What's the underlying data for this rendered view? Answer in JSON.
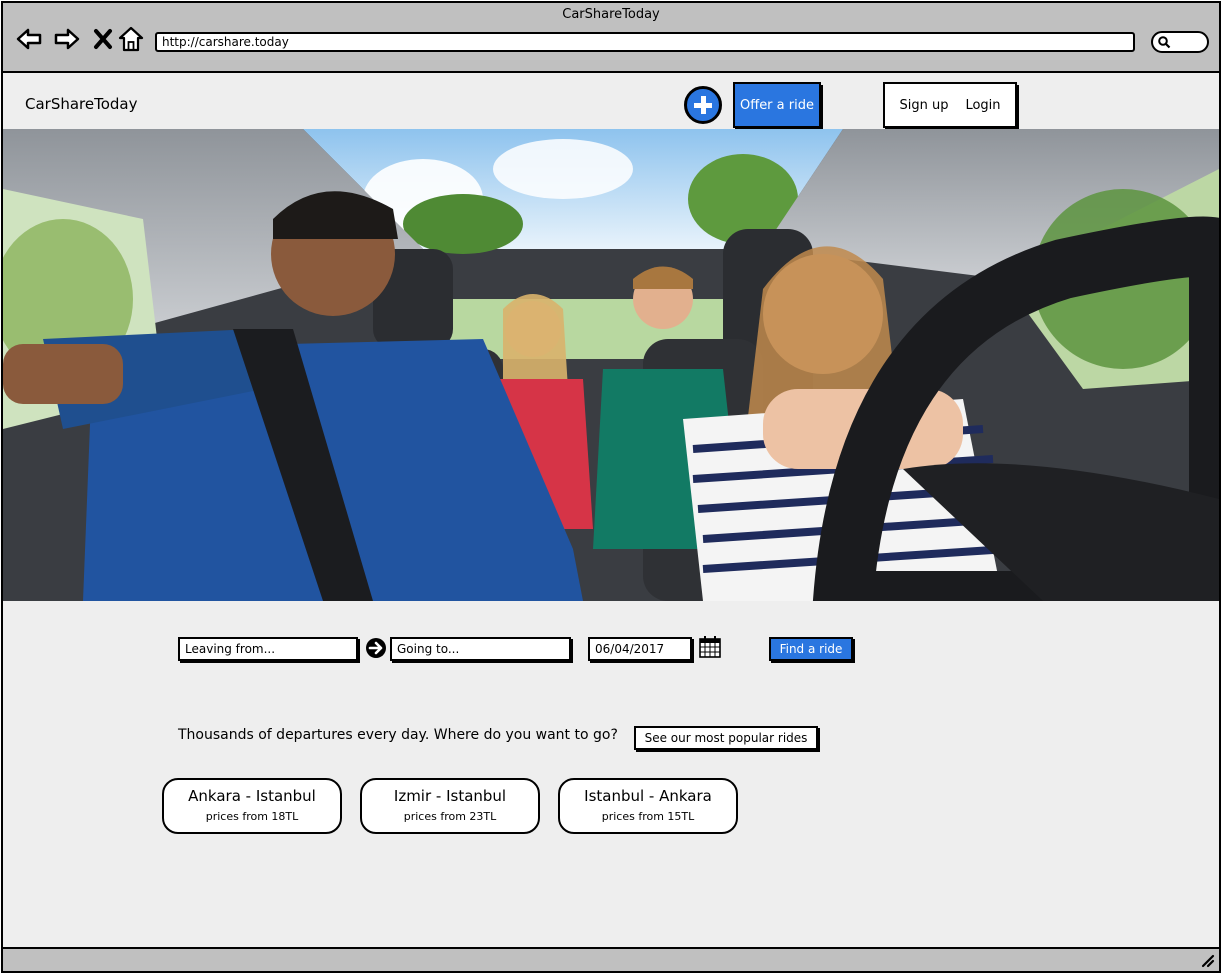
{
  "window": {
    "title": "CarShareToday"
  },
  "browser": {
    "url": "http://carshare.today"
  },
  "header": {
    "brand": "CarShareToday",
    "offer_label": "Offer a ride",
    "signup_label": "Sign up",
    "login_label": "Login"
  },
  "search": {
    "leaving_placeholder": "Leaving from...",
    "going_placeholder": "Going to...",
    "date_value": "06/04/2017",
    "find_label": "Find a ride"
  },
  "promo": {
    "tagline": "Thousands of departures every day. Where do you want to go?",
    "popular_label": "See our most popular rides"
  },
  "routes": [
    {
      "route": "Ankara - Istanbul",
      "price": "prices from 18TL"
    },
    {
      "route": "Izmir - Istanbul",
      "price": "prices from 23TL"
    },
    {
      "route": "Istanbul - Ankara",
      "price": "prices from 15TL"
    }
  ],
  "colors": {
    "accent": "#2a76e0",
    "chrome": "#c0c0c0",
    "page": "#eeeeee"
  },
  "icons": [
    "back-icon",
    "forward-icon",
    "stop-icon",
    "home-icon",
    "search-icon",
    "add-icon",
    "arrow-right-icon",
    "calendar-icon",
    "resize-icon"
  ]
}
